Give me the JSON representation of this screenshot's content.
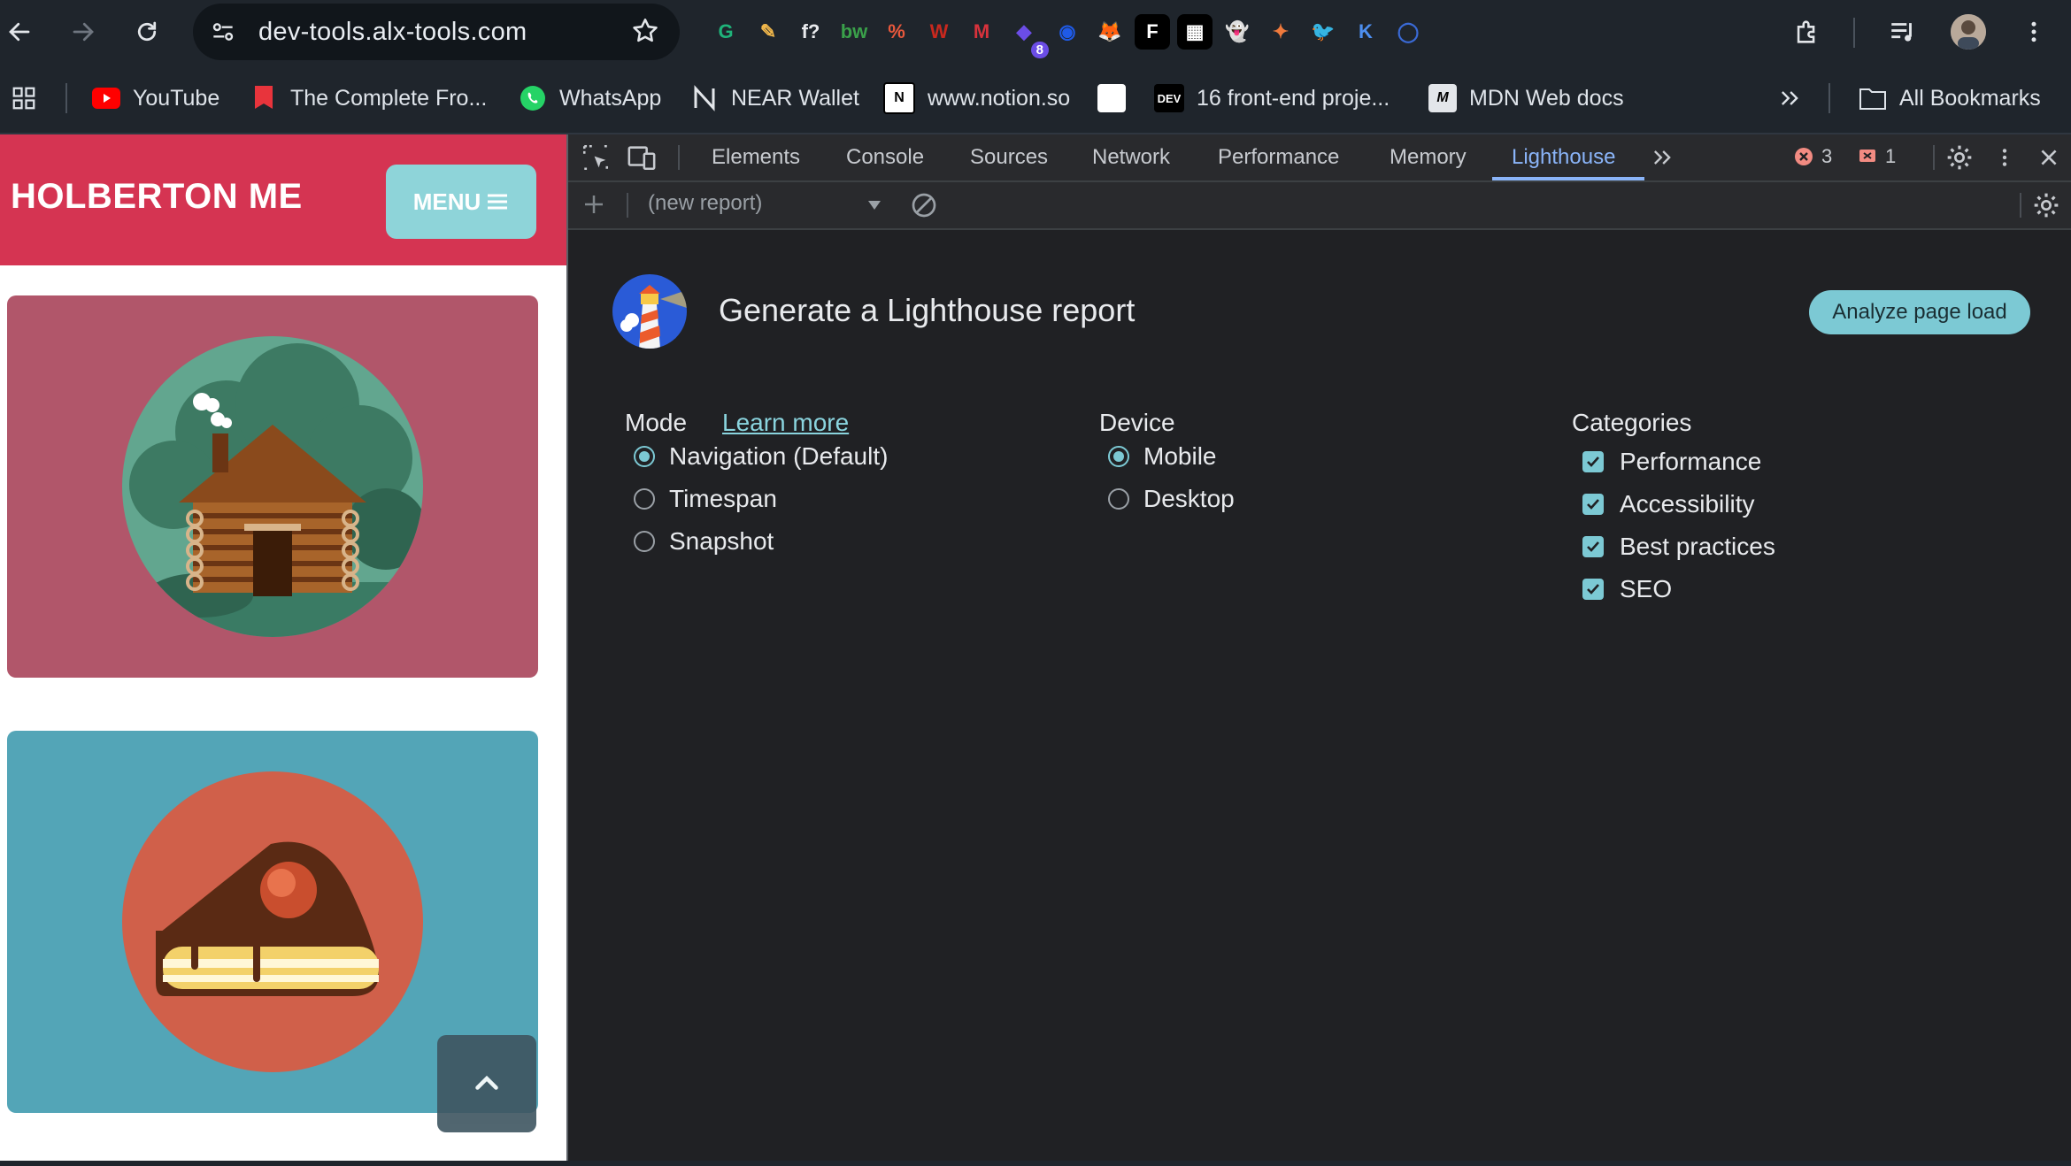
{
  "browser": {
    "url": "dev-tools.alx-tools.com",
    "extension_badge_count": "8",
    "extensions": [
      {
        "name": "grammarly-icon",
        "glyph": "G",
        "color": "#1fb47a"
      },
      {
        "name": "color-picker-icon",
        "glyph": "✎",
        "color": "#f2b84b"
      },
      {
        "name": "font-finder-icon",
        "glyph": "f?",
        "color": "#e8eaed"
      },
      {
        "name": "builtwith-icon",
        "glyph": "bw",
        "color": "#3aa04a"
      },
      {
        "name": "percent-extension-icon",
        "glyph": "%",
        "color": "#e8583c"
      },
      {
        "name": "w-extension-icon",
        "glyph": "W",
        "color": "#c8281e"
      },
      {
        "name": "mendeley-icon",
        "glyph": "M",
        "color": "#d8323c"
      },
      {
        "name": "wallet-badge-icon",
        "glyph": "◆",
        "color": "#6b4de6"
      },
      {
        "name": "coinbase-icon",
        "glyph": "◉",
        "color": "#1f5ae6"
      },
      {
        "name": "metamask-icon",
        "glyph": "🦊",
        "color": "#e88a2c"
      },
      {
        "name": "f-extension-icon",
        "glyph": "F",
        "color": "#000000"
      },
      {
        "name": "qr-extension-icon",
        "glyph": "▦",
        "color": "#000000"
      },
      {
        "name": "ghost-extension-icon",
        "glyph": "👻",
        "color": "#8c7bf0"
      },
      {
        "name": "spark-extension-icon",
        "glyph": "✦",
        "color": "#f07a3c"
      },
      {
        "name": "bird-extension-icon",
        "glyph": "🐦",
        "color": "#5a7bf0"
      },
      {
        "name": "k-extension-icon",
        "glyph": "K",
        "color": "#4d8ff0"
      },
      {
        "name": "ring-extension-icon",
        "glyph": "◯",
        "color": "#3a6ad6"
      }
    ]
  },
  "bookmarks": {
    "items": [
      {
        "label": "YouTube"
      },
      {
        "label": "The Complete Fro..."
      },
      {
        "label": "WhatsApp"
      },
      {
        "label": "NEAR Wallet"
      },
      {
        "label": "www.notion.so"
      },
      {
        "label": ""
      },
      {
        "label": "16 front-end proje..."
      },
      {
        "label": "MDN Web docs"
      }
    ],
    "dev_icon_text": "DEV",
    "all_bookmarks": "All Bookmarks"
  },
  "page": {
    "logo": "HOLBERTON ME",
    "menu_label": "MENU",
    "colors": {
      "header": "#d53452",
      "card1": "#b1566a",
      "card2": "#53a5b7",
      "menu": "#8ed4d9"
    }
  },
  "devtools": {
    "tabs": [
      "Elements",
      "Console",
      "Sources",
      "Network",
      "Performance",
      "Memory",
      "Lighthouse"
    ],
    "active_tab": "Lighthouse",
    "error_count": "3",
    "issue_count": "1",
    "report_select": "(new report)"
  },
  "lighthouse": {
    "title": "Generate a Lighthouse report",
    "analyze_button": "Analyze page load",
    "mode": {
      "label": "Mode",
      "learn_more": "Learn more",
      "options": [
        "Navigation (Default)",
        "Timespan",
        "Snapshot"
      ],
      "selected": "Navigation (Default)"
    },
    "device": {
      "label": "Device",
      "options": [
        "Mobile",
        "Desktop"
      ],
      "selected": "Mobile"
    },
    "categories": {
      "label": "Categories",
      "items": [
        "Performance",
        "Accessibility",
        "Best practices",
        "SEO"
      ],
      "checked": [
        true,
        true,
        true,
        true
      ]
    },
    "accent_color": "#7cc9d4"
  }
}
